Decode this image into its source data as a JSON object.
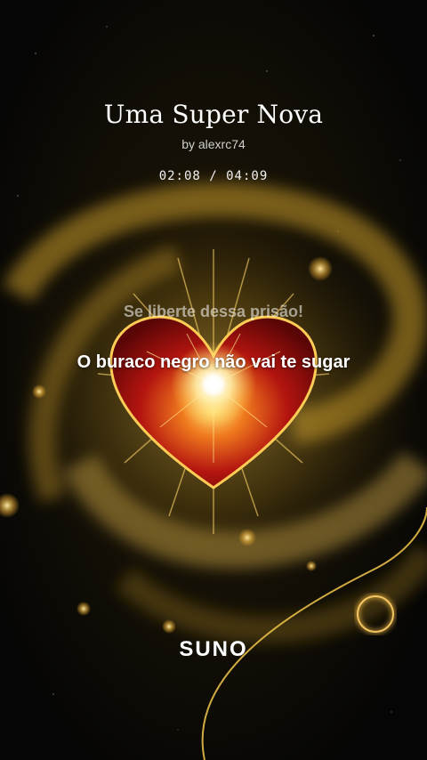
{
  "song": {
    "title": "Uma Super Nova",
    "artist": "by alexrc74"
  },
  "playback": {
    "elapsed": "02:08",
    "separator": "/",
    "duration": "04:09",
    "time_display": "02:08 / 04:09",
    "progress": 0.514
  },
  "lyrics": {
    "previous_line": "Se liberte dessa prisão!",
    "current_line": "O buraco negro não vai te sugar"
  },
  "branding": {
    "logo_text": "SUNO"
  },
  "colors": {
    "background": "#050505",
    "galaxy_gold": "#d9a928",
    "heart_red": "#b3140f",
    "glow_white": "#fff6d8"
  }
}
